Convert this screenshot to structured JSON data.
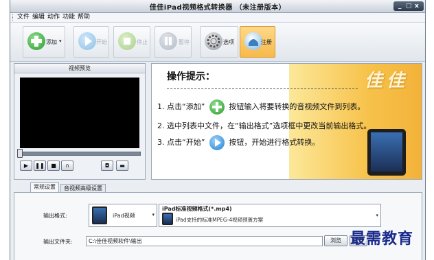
{
  "window": {
    "title": "佳佳iPad视频格式转换器 （未注册版本）"
  },
  "menu": {
    "items": [
      "文件",
      "编辑",
      "动作",
      "功能",
      "帮助"
    ]
  },
  "toolbar": {
    "add": "添加",
    "start": "开始",
    "stop": "停止",
    "pause": "暂停",
    "options": "选项",
    "register": "注册"
  },
  "preview": {
    "title": "视频预览"
  },
  "tips": {
    "title": "操作提示：",
    "line1a": "1. 点击“添加”",
    "line1b": "按钮输入将要转换的音视频文件到列表。",
    "line2": "2. 选中列表中文件，在“输出格式”选项框中更改当前输出格式。",
    "line3a": "3. 点击“开始”",
    "line3b": "按钮，开始进行格式转换。",
    "brand": "佳佳"
  },
  "tabs": [
    "常规设置",
    "音视频高级设置"
  ],
  "settings": {
    "format_label": "输出格式:",
    "device": "iPad视频",
    "format_name": "iPad标准视频格式(*.mp4)",
    "format_desc": "iPad支持的标准MPEG-4视频预置方案",
    "folder_label": "输出文件夹:",
    "folder_value": "C:\\佳佳视频软件\\输出",
    "browse": "浏览",
    "open": "打开"
  },
  "watermark": "最需教育",
  "colors": {
    "accent": "#f7c24a",
    "green": "#3db33d",
    "blue": "#1f8fe0"
  }
}
